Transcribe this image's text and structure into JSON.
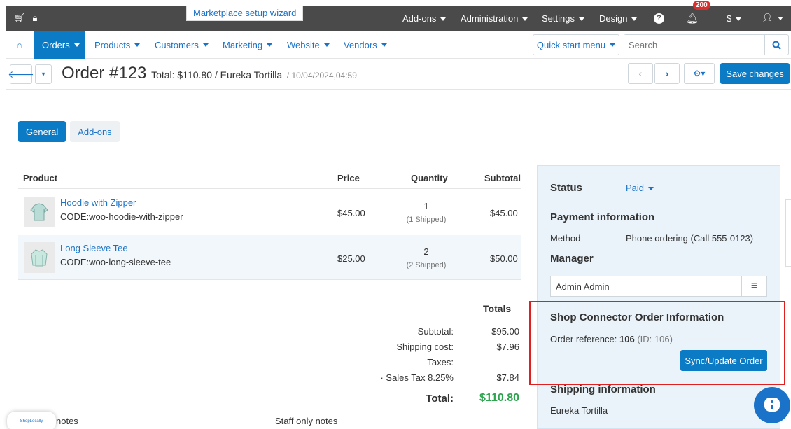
{
  "topbar": {
    "wizard": "Marketplace setup wizard",
    "menus": [
      "Add-ons",
      "Administration",
      "Settings",
      "Design"
    ],
    "notifications_count": "200",
    "currency": "$"
  },
  "nav": {
    "items": [
      "Orders",
      "Products",
      "Customers",
      "Marketing",
      "Website",
      "Vendors"
    ],
    "quick_start": "Quick start menu",
    "search_placeholder": "Search"
  },
  "order": {
    "title": "Order #123",
    "summary": "Total: $110.80 / Eureka Tortilla",
    "date": "/ 10/04/2024,04:59",
    "save": "Save changes"
  },
  "tabs": [
    "General",
    "Add-ons"
  ],
  "table": {
    "headers": [
      "Product",
      "Price",
      "Quantity",
      "Subtotal"
    ],
    "rows": [
      {
        "name": "Hoodie with Zipper",
        "code": "CODE:woo-hoodie-with-zipper",
        "price": "$45.00",
        "qty": "1",
        "shipped": "(1 Shipped)",
        "subtotal": "$45.00"
      },
      {
        "name": "Long Sleeve Tee",
        "code": "CODE:woo-long-sleeve-tee",
        "price": "$25.00",
        "qty": "2",
        "shipped": "(2 Shipped)",
        "subtotal": "$50.00"
      }
    ]
  },
  "totals": {
    "title": "Totals",
    "lines": [
      {
        "label": "Subtotal:",
        "value": "$95.00"
      },
      {
        "label": "Shipping cost:",
        "value": "$7.96"
      },
      {
        "label": "Taxes:",
        "value": ""
      },
      {
        "label": "· Sales Tax 8.25%",
        "value": "$7.84"
      }
    ],
    "total_label": "Total:",
    "total_value": "$110.80"
  },
  "notes": {
    "customer": "notes",
    "staff": "Staff only notes"
  },
  "sidebar": {
    "status_label": "Status",
    "status_value": "Paid",
    "payment_title": "Payment information",
    "method_label": "Method",
    "method_value": "Phone ordering (Call 555-0123)",
    "manager_title": "Manager",
    "manager_value": "Admin Admin",
    "connector_title": "Shop Connector Order Information",
    "order_ref_label": "Order reference:",
    "order_ref_value": "106",
    "order_ref_id": "(ID: 106)",
    "sync_button": "Sync/Update Order",
    "shipping_title": "Shipping information",
    "shipping_name": "Eureka Tortilla"
  },
  "logo_text": "ShopLocally",
  "colors": {
    "primary": "#0b7bc6",
    "link": "#1a73c8",
    "total_green": "#2ea44f",
    "highlight": "#e02020",
    "topbar": "#4a4a4a"
  }
}
